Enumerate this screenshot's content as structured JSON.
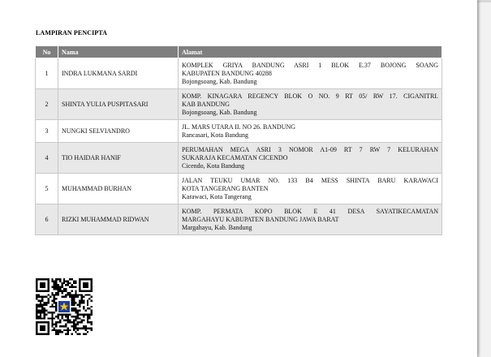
{
  "document": {
    "heading": "LAMPIRAN PENCIPTA",
    "columns": {
      "no": "No",
      "name": "Nama",
      "address": "Alamat"
    },
    "rows": [
      {
        "no": "1",
        "name": "INDRA LUKMANA SARDI",
        "address_lines": [
          "KOMPLEK GRIYA BANDUNG ASRI 1 BLOK E.37 BOJONG SOANG",
          "KABUPATEN BANDUNG 40288"
        ],
        "city": "Bojongsoang, Kab. Bandung"
      },
      {
        "no": "2",
        "name": "SHINTA YULIA PUSPITASARI",
        "address_lines": [
          "KOMP. KINAGARA REGENCY BLOK O NO. 9 RT 05/ RW 17. CIGANITRI.",
          "KAB BANDUNG"
        ],
        "city": "Bojongsoang, Kab. Bandung"
      },
      {
        "no": "3",
        "name": "NUNGKI SELVIANDRO",
        "address_lines": [
          "JL. MARS UTARA II. NO 26. BANDUNG"
        ],
        "city": "Rancasari, Kota Bandung"
      },
      {
        "no": "4",
        "name": "TIO HAIDAR HANIF",
        "address_lines": [
          "PERUMAHAN MEGA ASRI 3 NOMOR A1-09 RT 7 RW 7 KELURAHAN",
          "SUKARAJA KECAMATAN CICENDO"
        ],
        "city": "Cicendo, Kota Bandung"
      },
      {
        "no": "5",
        "name": "MUHAMMAD BURHAN",
        "address_lines": [
          "JALAN TEUKU UMAR NO. 133 B4 MESS SHINTA BARU KARAWACI",
          "KOTA TANGERANG BANTEN"
        ],
        "city": "Karawaci, Kota Tangerang"
      },
      {
        "no": "6",
        "name": "RIZKI MUHAMMAD RIDWAN",
        "address_lines": [
          "KOMP. PERMATA KOPO BLOK E 41 DESA SAYATIKECAMATAN",
          "MARGAHAYU KABUPATEN BANDUNG JAWA BARAT"
        ],
        "city": "Margahayu, Kab. Bandung"
      }
    ],
    "qr_code": {
      "icon": "qr-code-with-emblem-icon",
      "dark_color": "#000000",
      "emblem_color": "#1f3f8f"
    }
  }
}
